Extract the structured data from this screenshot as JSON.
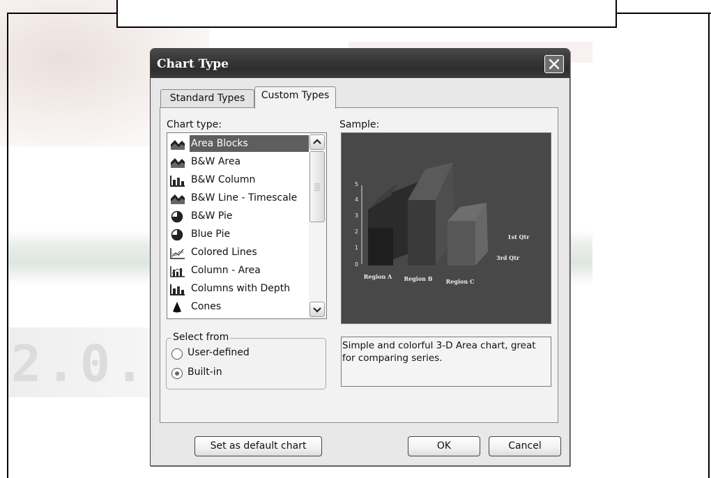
{
  "dialog": {
    "title": "Chart Type",
    "close_icon": "close-icon"
  },
  "tabs": [
    {
      "label": "Standard Types",
      "active": false
    },
    {
      "label": "Custom Types",
      "active": true
    }
  ],
  "chart_type_label": "Chart type:",
  "chart_types": [
    {
      "label": "Area Blocks",
      "icon": "area-chart-icon",
      "selected": true
    },
    {
      "label": "B&W Area",
      "icon": "area-chart-icon"
    },
    {
      "label": "B&W Column",
      "icon": "column-chart-icon"
    },
    {
      "label": "B&W Line - Timescale",
      "icon": "area-chart-icon"
    },
    {
      "label": "B&W Pie",
      "icon": "pie-chart-icon"
    },
    {
      "label": "Blue Pie",
      "icon": "pie-chart-icon"
    },
    {
      "label": "Colored Lines",
      "icon": "line-chart-icon"
    },
    {
      "label": "Column - Area",
      "icon": "column-area-chart-icon"
    },
    {
      "label": "Columns with Depth",
      "icon": "column-chart-icon"
    },
    {
      "label": "Cones",
      "icon": "cone-chart-icon"
    }
  ],
  "select_from": {
    "legend": "Select from",
    "options": [
      {
        "label": "User-defined",
        "checked": false
      },
      {
        "label": "Built-in",
        "checked": true
      }
    ]
  },
  "sample": {
    "label": "Sample:",
    "preview": {
      "y_ticks": [
        "0",
        "1",
        "2",
        "3",
        "4",
        "5"
      ],
      "categories": [
        "Region A",
        "Region B",
        "Region C"
      ],
      "legend": [
        "1st Qtr",
        "3rd Qtr"
      ]
    }
  },
  "description": "Simple and colorful 3-D Area chart, great for comparing series.",
  "buttons": {
    "set_default": "Set as default chart",
    "ok": "OK",
    "cancel": "Cancel"
  }
}
